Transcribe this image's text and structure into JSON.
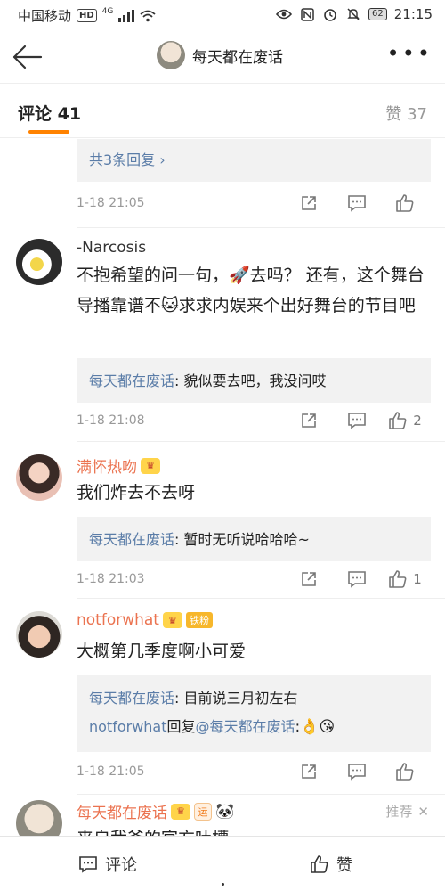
{
  "status_bar": {
    "carrier": "中国移动",
    "network_badge": "HD",
    "network_type": "4G",
    "battery": "62",
    "time": "21:15"
  },
  "header": {
    "title": "每天都在废话"
  },
  "tabs": {
    "comments_label": "评论 41",
    "likes_label": "赞 37"
  },
  "comments": [
    {
      "more_replies": "共3条回复",
      "time": "1-18 21:05"
    },
    {
      "username": "-Narcosis",
      "text": "不抱希望的问一句，🚀去吗？ 还有，这个舞台导播靠谱不🐱求求内娱来个出好舞台的节目吧",
      "reply_author": "每天都在废话",
      "reply_text": ": 貌似要去吧，我没问哎",
      "time": "1-18 21:08",
      "likes": "2"
    },
    {
      "username": "满怀热吻",
      "text": "我们炸去不去呀",
      "reply_author": "每天都在废话",
      "reply_text": ": 暂时无听说哈哈哈~",
      "time": "1-18 21:03",
      "likes": "1"
    },
    {
      "username": "notforwhat",
      "fan_badge": "铁粉",
      "text": "大概第几季度啊小可爱",
      "reply_author": "每天都在废话",
      "reply_text": ": 目前说三月初左右",
      "reply2_author": "notforwhat",
      "reply2_mid": "回复",
      "reply2_target": "@每天都在废话",
      "reply2_text": ":👌😘",
      "time": "1-18 21:05"
    },
    {
      "username": "每天都在废话",
      "yun_badge": "运",
      "panda": "🐼",
      "recommend": "推荐",
      "text": "来自我爸的官方吐槽"
    }
  ],
  "bottom_bar": {
    "comment_label": "评论",
    "like_label": "赞"
  },
  "colors": {
    "accent": "#ff8200",
    "username": "#eb7350",
    "link": "#5b7da8"
  }
}
